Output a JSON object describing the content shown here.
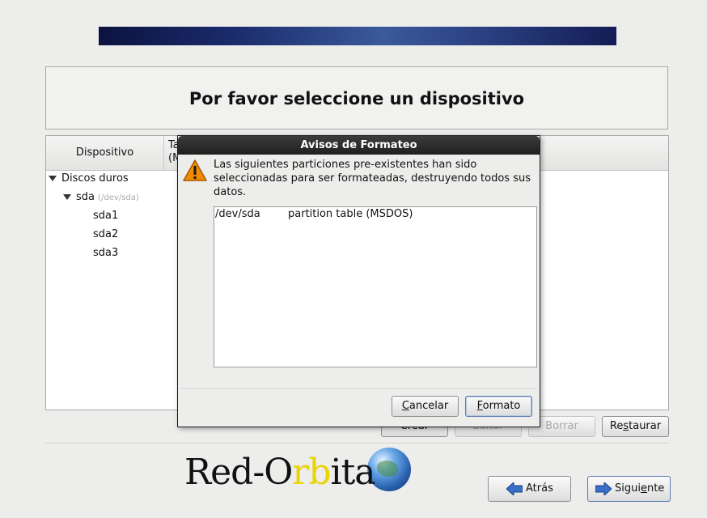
{
  "page": {
    "title": "Por favor seleccione un dispositivo"
  },
  "tree": {
    "columns": [
      "Dispositivo",
      "Ta",
      "(M"
    ],
    "items": [
      {
        "label": "Discos duros",
        "sub": ""
      },
      {
        "label": "sda",
        "sub": "(/dev/sda)"
      },
      {
        "label": "sda1",
        "sub": ""
      },
      {
        "label": "sda2",
        "sub": ""
      },
      {
        "label": "sda3",
        "sub": ""
      }
    ]
  },
  "actions": {
    "create": "Crear",
    "edit": "Editar",
    "delete": "Borrar",
    "restore_pre": "Re",
    "restore_u": "s",
    "restore_post": "taurar"
  },
  "dialog": {
    "title": "Avisos de Formateo",
    "message": "Las siguientes particiones pre-existentes han sido seleccionadas para ser formateadas, destruyendo todos sus datos.",
    "rows": [
      {
        "device": "/dev/sda",
        "description": "partition table (MSDOS)"
      }
    ],
    "cancel_u": "C",
    "cancel_rest": "ancelar",
    "format_u": "F",
    "format_rest": "ormato"
  },
  "nav": {
    "back": "Atrás",
    "next_pre": "Sigui",
    "next_u": "e",
    "next_post": "nte"
  },
  "logo": {
    "pre": "Red-O",
    "r": "r",
    "b": "b",
    "post": "ita"
  },
  "colors": {
    "banner_dark": "#0c1340",
    "arrow_blue": "#3a6fc8",
    "warning": "#f08a00"
  }
}
